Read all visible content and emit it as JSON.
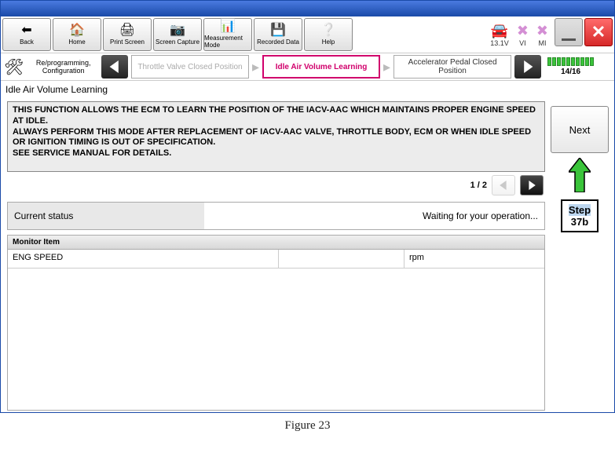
{
  "toolbar": {
    "back": "Back",
    "home": "Home",
    "print": "Print Screen",
    "capture": "Screen Capture",
    "measurement": "Measurement Mode",
    "recorded": "Recorded Data",
    "help": "Help"
  },
  "status": {
    "voltage": "13.1V",
    "vi": "VI",
    "mi": "MI"
  },
  "breadcrumb": {
    "config": "Re/programming, Configuration",
    "prev": "Throttle Valve Closed Position",
    "current": "Idle Air Volume Learning",
    "next": "Accelerator Pedal Closed Position",
    "progress": "14/16"
  },
  "section_title": "Idle Air Volume Learning",
  "info_text": "THIS FUNCTION ALLOWS THE ECM TO LEARN THE POSITION OF THE IACV-AAC WHICH MAINTAINS PROPER ENGINE SPEED AT IDLE.\nALWAYS PERFORM THIS MODE AFTER REPLACEMENT OF IACV-AAC VALVE, THROTTLE BODY, ECM OR WHEN IDLE SPEED OR IGNITION TIMING IS OUT OF SPECIFICATION.\nSEE SERVICE MANUAL FOR DETAILS.",
  "pager": {
    "label": "1 / 2"
  },
  "current_status": {
    "label": "Current status",
    "value": "Waiting for your operation..."
  },
  "monitor": {
    "header": "Monitor Item",
    "rows": [
      {
        "name": "ENG SPEED",
        "value": "",
        "unit": "rpm"
      }
    ]
  },
  "next_label": "Next",
  "callout": {
    "line1": "Step",
    "line2": "37b"
  },
  "figure": "Figure 23"
}
